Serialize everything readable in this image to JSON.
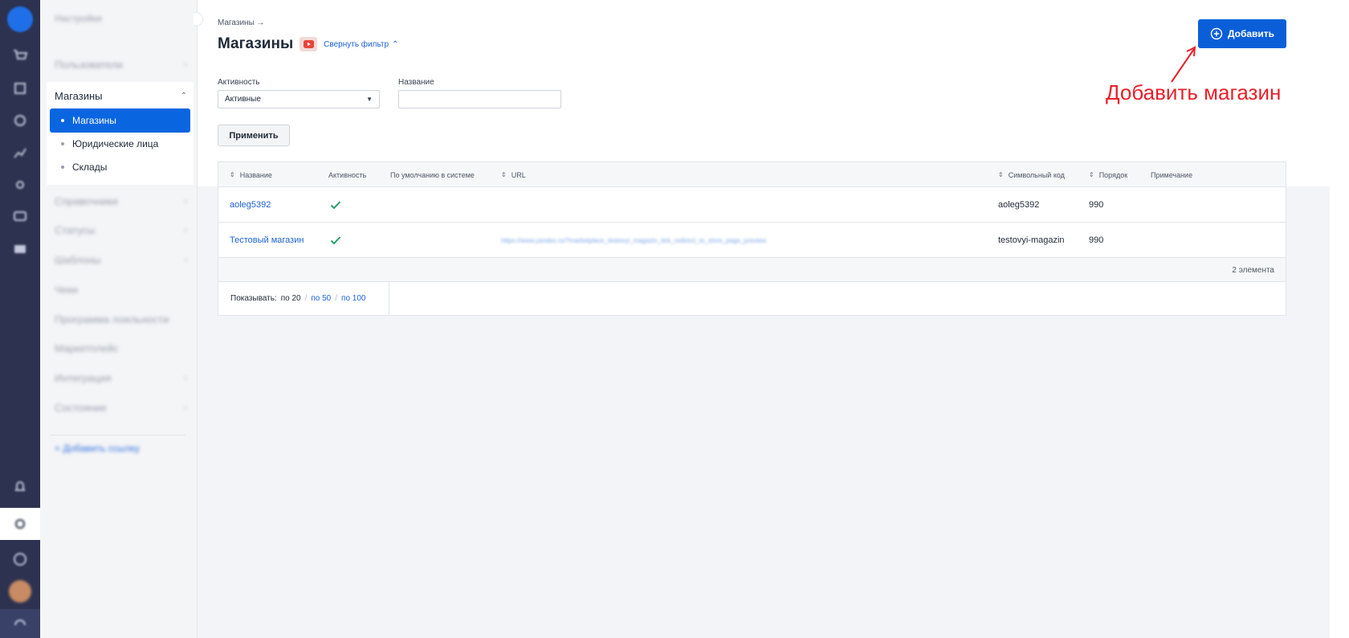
{
  "sidebar": {
    "title": "Настройки",
    "group_open": "Магазины",
    "items_top": [
      "Пользователи"
    ],
    "items_bottom": [
      "Справочники",
      "Статусы",
      "Шаблоны",
      "Чеки",
      "Программа лояльности",
      "Маркетплейс",
      "Интеграция",
      "Состояние"
    ],
    "sub_items": [
      "Магазины",
      "Юридические лица",
      "Склады"
    ],
    "add_link": "Добавить ссылку"
  },
  "header": {
    "breadcrumb": "Магазины →",
    "title": "Магазины",
    "filter_toggle": "Свернуть фильтр",
    "add_button": "Добавить"
  },
  "annotation": {
    "text": "Добавить магазин",
    "color": "#e8202a"
  },
  "filter": {
    "activity_label": "Активность",
    "activity_value": "Активные",
    "name_label": "Название",
    "name_value": "",
    "apply_button": "Применить"
  },
  "table": {
    "headers": [
      "Название",
      "Активность",
      "По умолчанию в системе",
      "URL",
      "Символьный код",
      "Порядок",
      "Примечание"
    ],
    "rows": [
      {
        "name": "aoleg5392",
        "active": true,
        "default": "",
        "url": "",
        "code": "aoleg5392",
        "order": "990",
        "note": ""
      },
      {
        "name": "Тестовый магазин",
        "active": true,
        "default": "",
        "url": "https://www.yandex.ru/?marketplace_testovyi_magazin_link_redirect_to_store_page_preview",
        "code": "testovyi-magazin",
        "order": "990",
        "note": ""
      }
    ],
    "count": "2 элемента"
  },
  "pager": {
    "label": "Показывать:",
    "current": "по 20",
    "options": [
      "по 50",
      "по 100"
    ],
    "separator": "/"
  },
  "colors": {
    "primary": "#0a5fd8",
    "link": "#1d61d6",
    "check": "#22a06b",
    "rail": "#2d3250"
  }
}
